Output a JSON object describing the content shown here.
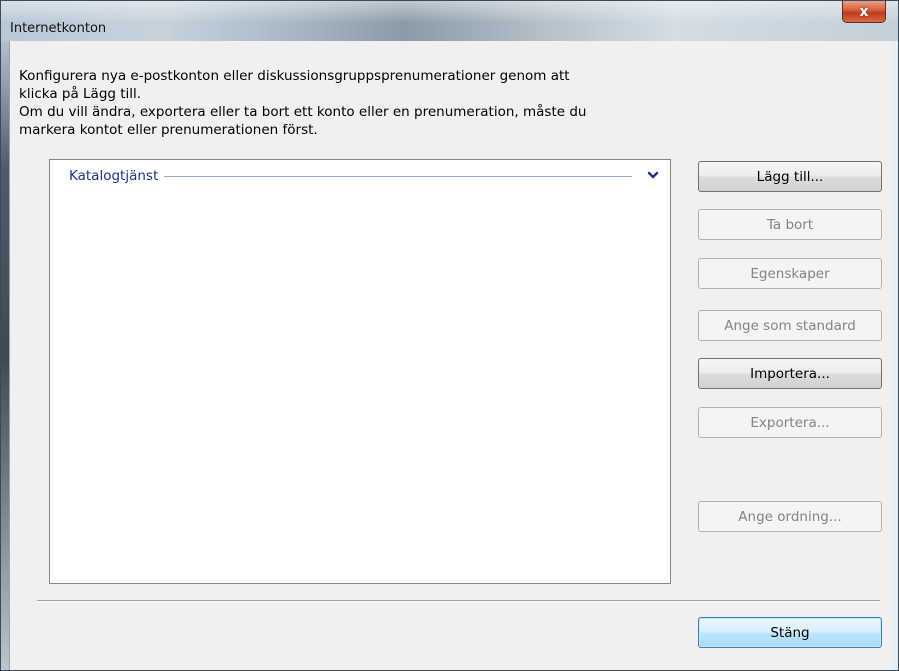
{
  "window": {
    "title": "Internetkonton",
    "close_symbol": "x"
  },
  "description": {
    "line1": "Konfigurera nya e-postkonton eller diskussionsgruppsprenumerationer genom att",
    "line2": "klicka på Lägg till.",
    "line3": "Om du vill ändra, exportera eller ta bort ett konto eller en prenumeration, måste du",
    "line4": "markera kontot eller prenumerationen först."
  },
  "list": {
    "group_label": "Katalogtjänst",
    "group_icon": "chevron-down-icon"
  },
  "buttons": {
    "add": {
      "label": "Lägg till...",
      "enabled": true
    },
    "remove": {
      "label": "Ta bort",
      "enabled": false
    },
    "properties": {
      "label": "Egenskaper",
      "enabled": false
    },
    "set_default": {
      "label": "Ange som standard",
      "enabled": false
    },
    "import": {
      "label": "Importera...",
      "enabled": true
    },
    "export": {
      "label": "Exportera...",
      "enabled": false
    },
    "set_order": {
      "label": "Ange ordning...",
      "enabled": false
    },
    "close": {
      "label": "Stäng",
      "enabled": true
    }
  },
  "colors": {
    "group_text": "#1e3287",
    "disabled_text": "#838383",
    "default_button": "#a7d9f5",
    "close_button": "#c2381a"
  }
}
